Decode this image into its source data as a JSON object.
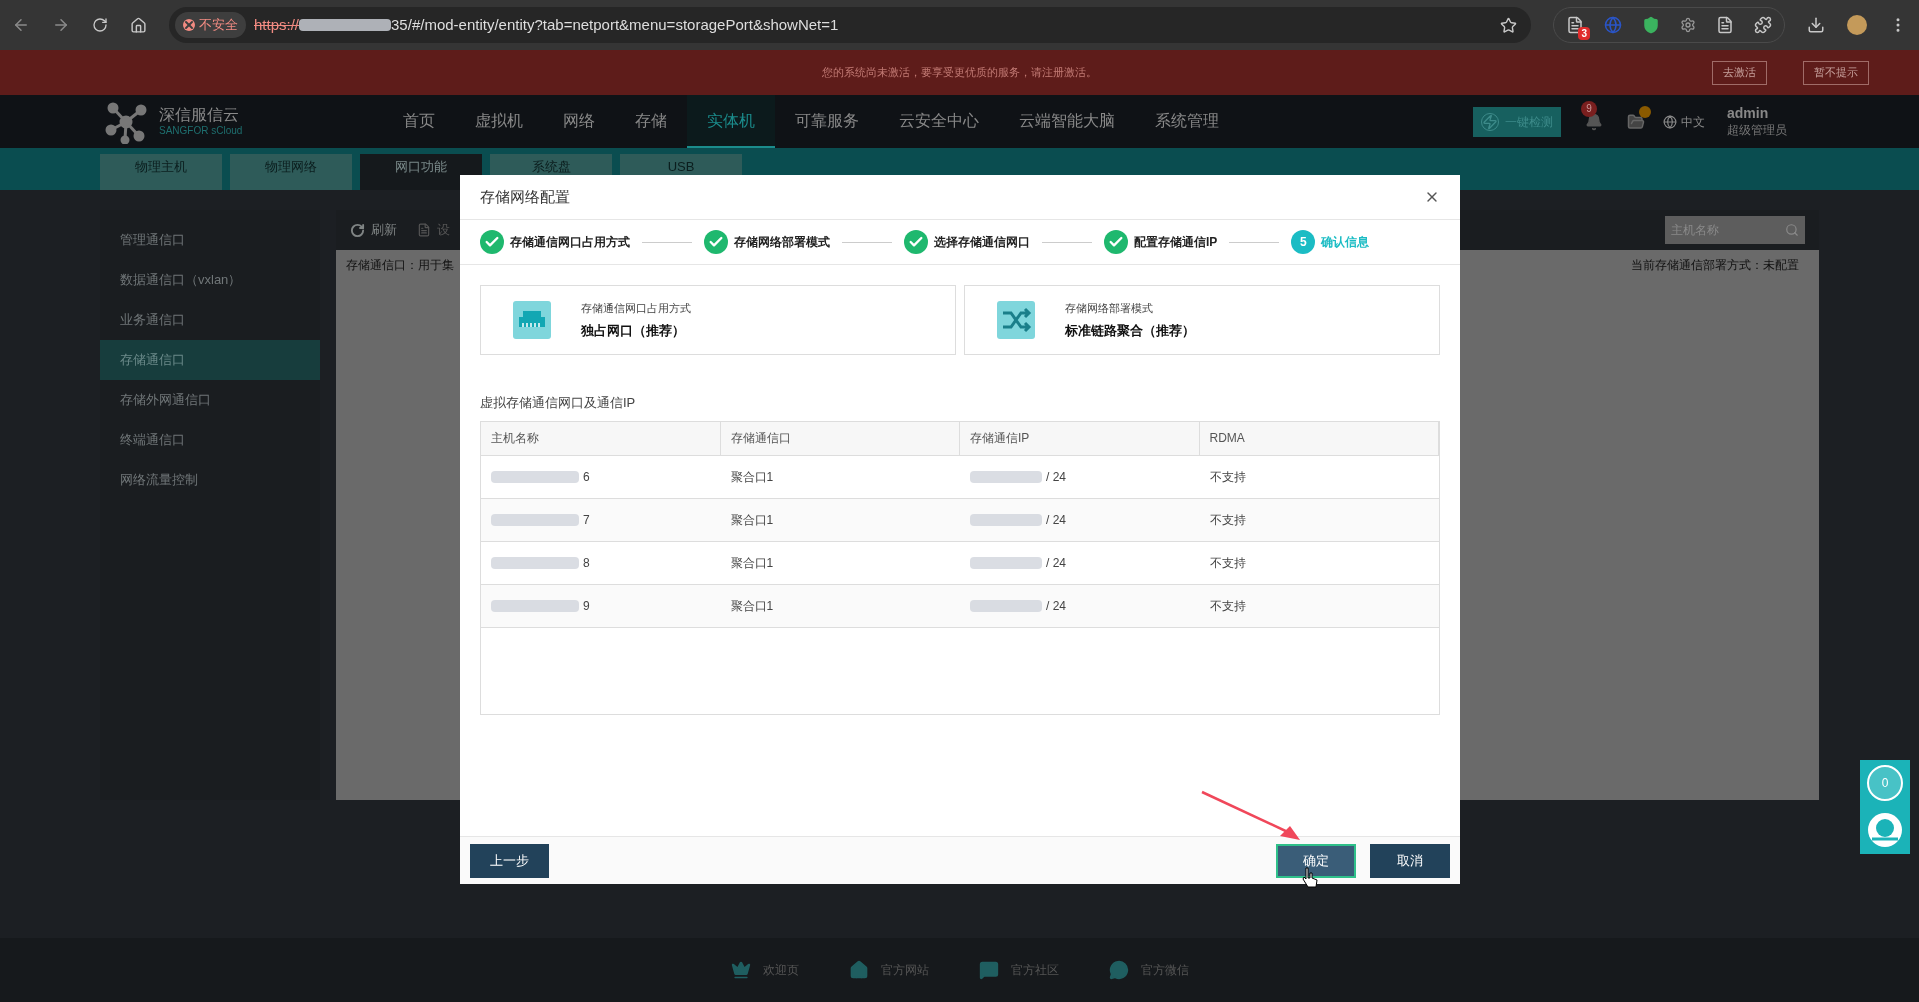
{
  "browser": {
    "security": "不安全",
    "url_scheme": "https://",
    "url_rest": "35/#/mod-entity/entity?tab=netport&menu=storagePort&showNet=1",
    "extension_badge": "3"
  },
  "banner": {
    "message": "您的系统尚未激活，要享受更优质的服务，请注册激活。",
    "buttons": [
      "去激活",
      "暂不提示"
    ]
  },
  "header": {
    "brand": "深信服信云",
    "brand_sub": "SANGFOR sCloud",
    "nav": [
      {
        "label": "首页",
        "selected": false
      },
      {
        "label": "虚拟机",
        "selected": false
      },
      {
        "label": "网络",
        "selected": false
      },
      {
        "label": "存储",
        "selected": false
      },
      {
        "label": "实体机",
        "selected": true
      },
      {
        "label": "可靠服务",
        "selected": false
      },
      {
        "label": "云安全中心",
        "selected": false
      },
      {
        "label": "云端智能大脑",
        "selected": false
      },
      {
        "label": "系统管理",
        "selected": false
      }
    ],
    "check_button": "一键检测",
    "notification_count": "9",
    "language": "中文",
    "user": "admin",
    "role": "超级管理员"
  },
  "subtabs": [
    {
      "label": "物理主机",
      "selected": false
    },
    {
      "label": "物理网络",
      "selected": false
    },
    {
      "label": "网口功能",
      "selected": true
    },
    {
      "label": "系统盘",
      "selected": false
    },
    {
      "label": "USB",
      "selected": false
    }
  ],
  "sidebar": {
    "items": [
      {
        "label": "管理通信口",
        "selected": false
      },
      {
        "label": "数据通信口（vxlan）",
        "selected": false
      },
      {
        "label": "业务通信口",
        "selected": false
      },
      {
        "label": "存储通信口",
        "selected": true
      },
      {
        "label": "存储外网通信口",
        "selected": false
      },
      {
        "label": "终端通信口",
        "selected": false
      },
      {
        "label": "网络流量控制",
        "selected": false
      }
    ]
  },
  "content": {
    "refresh": "刷新",
    "settings": "设",
    "description": "存储通信口：用于集",
    "search_placeholder": "主机名称",
    "deploy_status": "当前存储通信部署方式：未配置"
  },
  "dialog": {
    "title": "存储网络配置",
    "steps": [
      {
        "label": "存储通信网口占用方式",
        "done": true
      },
      {
        "label": "存储网络部署模式",
        "done": true
      },
      {
        "label": "选择存储通信网口",
        "done": true
      },
      {
        "label": "配置存储通信IP",
        "done": true
      },
      {
        "label": "确认信息",
        "done": false,
        "number": "5"
      }
    ],
    "cards": [
      {
        "kind": "port",
        "caption": "存储通信网口占用方式",
        "value": "独占网口（推荐）"
      },
      {
        "kind": "shuffle",
        "caption": "存储网络部署模式",
        "value": "标准链路聚合（推荐）"
      }
    ],
    "table_title": "虚拟存储通信网口及通信IP",
    "columns": [
      "主机名称",
      "存储通信口",
      "存储通信IP",
      "RDMA"
    ],
    "rows": [
      [
        "6",
        "聚合口1",
        "/ 24",
        "不支持"
      ],
      [
        "7",
        "聚合口1",
        "/ 24",
        "不支持"
      ],
      [
        "8",
        "聚合口1",
        "/ 24",
        "不支持"
      ],
      [
        "9",
        "聚合口1",
        "/ 24",
        "不支持"
      ]
    ],
    "back_button": "上一步",
    "ok_button": "确定",
    "cancel_button": "取消"
  },
  "footer": {
    "links": [
      {
        "kind": "welcome",
        "label": "欢迎页"
      },
      {
        "kind": "home",
        "label": "官方网站"
      },
      {
        "kind": "community",
        "label": "官方社区"
      },
      {
        "kind": "wechat",
        "label": "官方微信"
      }
    ]
  },
  "widget": {
    "count": "0"
  }
}
